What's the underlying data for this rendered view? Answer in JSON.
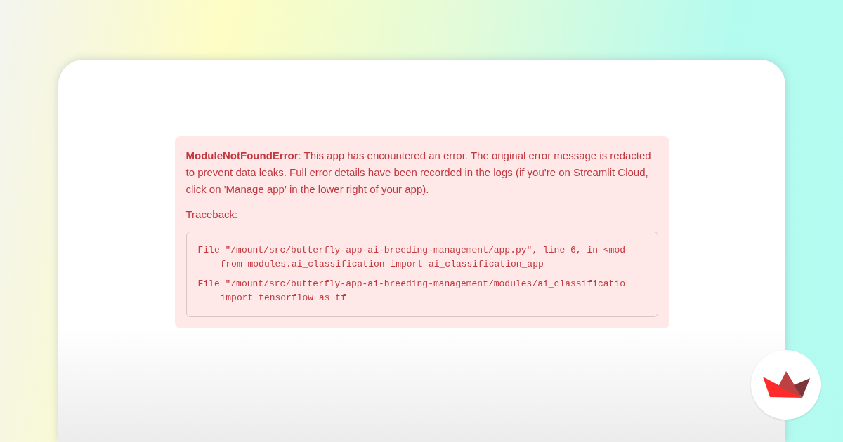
{
  "error": {
    "message": "**ModuleNotFoundError**: This app has encountered an error. The original error message is redacted to prevent data leaks. Full error details have been recorded in the logs (if you're on Streamlit Cloud, click on 'Manage app' in the lower right of your app).",
    "traceback_label": "Traceback:",
    "traceback": [
      {
        "file_line": "File \"/mount/src/butterfly-app-ai-breeding-management/app.py\", line 6, in <mod",
        "code": "from modules.ai_classification import ai_classification_app"
      },
      {
        "file_line": "File \"/mount/src/butterfly-app-ai-breeding-management/modules/ai_classificatio",
        "code": "import tensorflow as tf"
      }
    ]
  }
}
